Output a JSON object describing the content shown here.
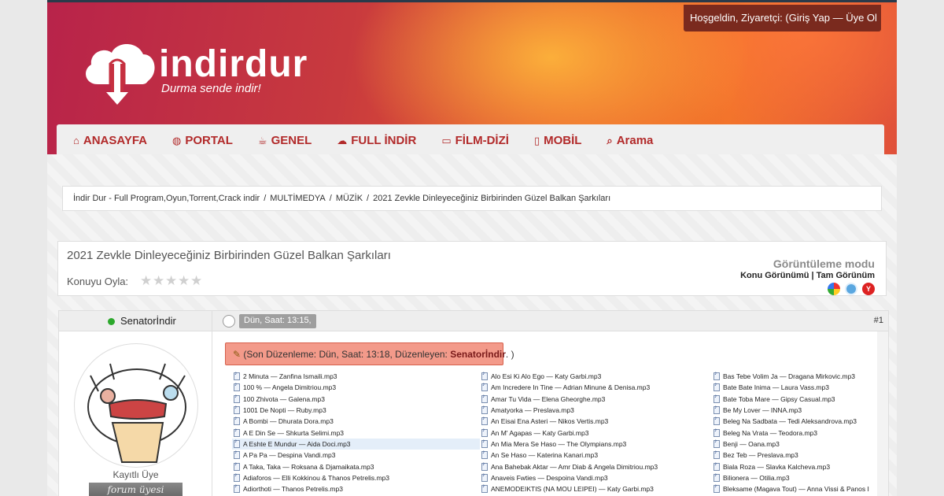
{
  "header": {
    "welcome": "Hoşgeldin, Ziyaretçi: (Giriş Yap — Üye Ol",
    "logo_text": "indirdur",
    "logo_sub": "Durma sende indir!"
  },
  "nav": [
    {
      "label": "ANASAYFA",
      "icon": "home-icon",
      "glyph": "⌂"
    },
    {
      "label": "PORTAL",
      "icon": "globe-icon",
      "glyph": "◍"
    },
    {
      "label": "GENEL",
      "icon": "coffee-icon",
      "glyph": "☕"
    },
    {
      "label": "FULL İNDİR",
      "icon": "cloud-download-icon",
      "glyph": "☁"
    },
    {
      "label": "FİLM-DİZİ",
      "icon": "monitor-icon",
      "glyph": "▭"
    },
    {
      "label": "MOBİL",
      "icon": "mobile-icon",
      "glyph": "▯"
    },
    {
      "label": "Arama",
      "icon": "search-icon",
      "glyph": "⌕"
    }
  ],
  "breadcrumb": [
    "İndir Dur - Full Program,Oyun,Torrent,Crack indir",
    "MULTİMEDYA",
    "MÜZİK",
    "2021 Zevkle Dinleyeceğiniz Birbirinden Güzel Balkan Şarkıları"
  ],
  "thread": {
    "title": "2021 Zevkle Dinleyeceğiniz Birbirinden Güzel Balkan Şarkıları",
    "rate_label": "Konuyu Oyla:",
    "viewmode_title": "Görüntüleme modu",
    "viewmode_links": "Konu Görünümü | Tam Görünüm"
  },
  "post": {
    "username": "Senatorİndir",
    "date": "Dün, Saat: 13:15,",
    "number": "#1",
    "user_title": "Kayıtlı Üye",
    "user_rank": "forum üyesi",
    "edit_prefix": "(Son Düzenleme: Dün, Saat: 13:18, Düzenleyen: ",
    "edit_user": "Senatorİndir",
    "edit_suffix": ". )"
  },
  "files": {
    "col1": [
      "2 Minuta — Zanfina Ismaili.mp3",
      "100 % — Angela Dimitriou.mp3",
      "100 Zhivota — Galena.mp3",
      "1001 De Nopti — Ruby.mp3",
      "A Bombi — Dhurata Dora.mp3",
      "A E Din Se — Shkurta Selimi.mp3",
      "A Eshte E Mundur — Aida Doci.mp3",
      "A Pa Pa — Despina Vandi.mp3",
      "A Taka, Taka — Roksana & Djamaikata.mp3",
      "Adiaforos — Elli Kokkinou & Thanos Petrelis.mp3",
      "Adiorthoti — Thanos Petrelis.mp3"
    ],
    "col2": [
      "Alo Esi Ki Alo Ego — Katy Garbi.mp3",
      "Am Incredere In Tine — Adrian Minune & Denisa.mp3",
      "Amar Tu Vida — Elena Gheorghe.mp3",
      "Amatyorka — Preslava.mp3",
      "An Eisai Ena Asteri — Nikos Vertis.mp3",
      "An M' Agapas — Katy Garbi.mp3",
      "An Mia Mera Se Haso — The Olympians.mp3",
      "An Se Haso — Katerina Kanari.mp3",
      "Ana Bahebak Aktar — Amr Diab & Angela Dimitriou.mp3",
      "Anaveis Fwties — Despoina Vandi.mp3",
      "ANEMODEIKTIS (NA MOU LEIPEI) — Katy Garbi.mp3"
    ],
    "col3": [
      "Bas Tebe Volim Ja — Dragana Mirkovic.mp3",
      "Bate Bate Inima — Laura Vass.mp3",
      "Bate Toba Mare — Gipsy Casual.mp3",
      "Be My Lover — INNA.mp3",
      "Beleg Na Sadbata — Tedi Aleksandrova.mp3",
      "Beleg Na Vrata — Teodora.mp3",
      "Benji — Oana.mp3",
      "Bez Teb — Preslava.mp3",
      "Biala Roza — Slavka Kalcheva.mp3",
      "Bilionera — Otilia.mp3",
      "Bleksame (Magava Tout) — Anna Vissi & Panos I"
    ]
  }
}
